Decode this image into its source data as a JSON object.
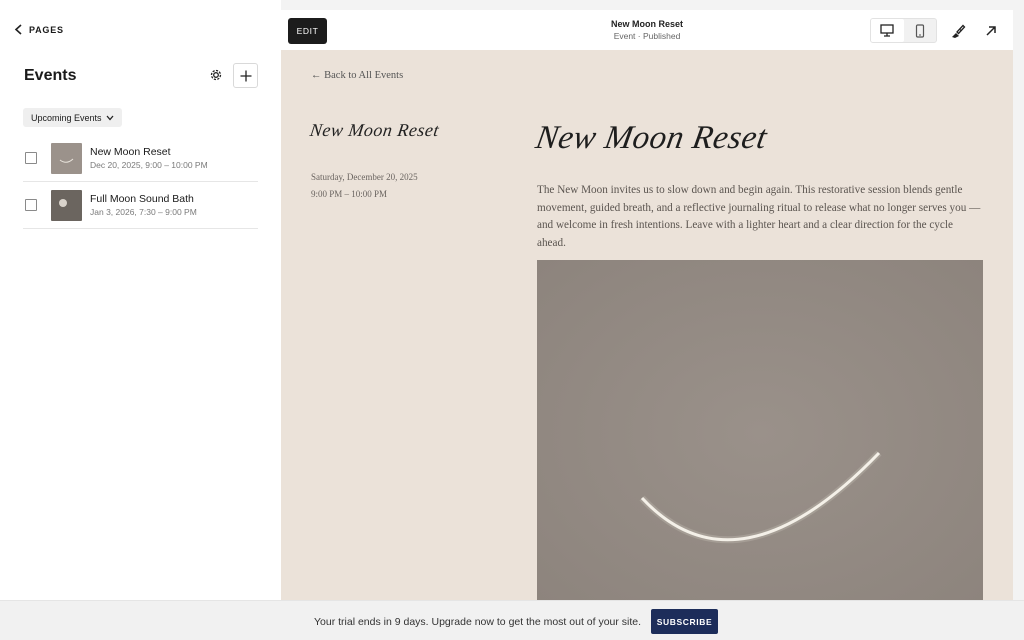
{
  "sidebar": {
    "back_label": "PAGES",
    "title": "Events",
    "filter_label": "Upcoming Events",
    "events": [
      {
        "name": "New Moon Reset",
        "date": "Dec 20, 2025, 9:00 – 10:00 PM",
        "thumb": "crescent-moon-thumbnail"
      },
      {
        "name": "Full Moon Sound Bath",
        "date": "Jan 3, 2026, 7:30 – 9:00 PM",
        "thumb": "full-moon-thumbnail"
      }
    ]
  },
  "topbar": {
    "edit_label": "EDIT",
    "page_title": "New Moon Reset",
    "page_status": "Event · Published",
    "icons": [
      "desktop-icon",
      "mobile-icon",
      "paintbrush-icon",
      "external-link-icon"
    ]
  },
  "preview": {
    "back_link": "← Back to All Events",
    "side_title": "New Moon Reset",
    "date": "Saturday, December 20, 2025",
    "time": "9:00 PM – 10:00 PM",
    "main_title": "New Moon Reset",
    "description": "The New Moon invites us to slow down and begin again. This restorative session blends gentle movement, guided breath, and a reflective journaling ritual to release what no longer serves you — and welcome in fresh intentions. Leave with a lighter heart and a clear direction for the cycle ahead."
  },
  "trial": {
    "message": "Your trial ends in 9 days. Upgrade now to get the most out of your site.",
    "subscribe_label": "SUBSCRIBE"
  },
  "colors": {
    "preview_background": "#ebe2d9",
    "subscribe_button": "#1d2d5a",
    "edit_button": "#1c1c1c"
  }
}
